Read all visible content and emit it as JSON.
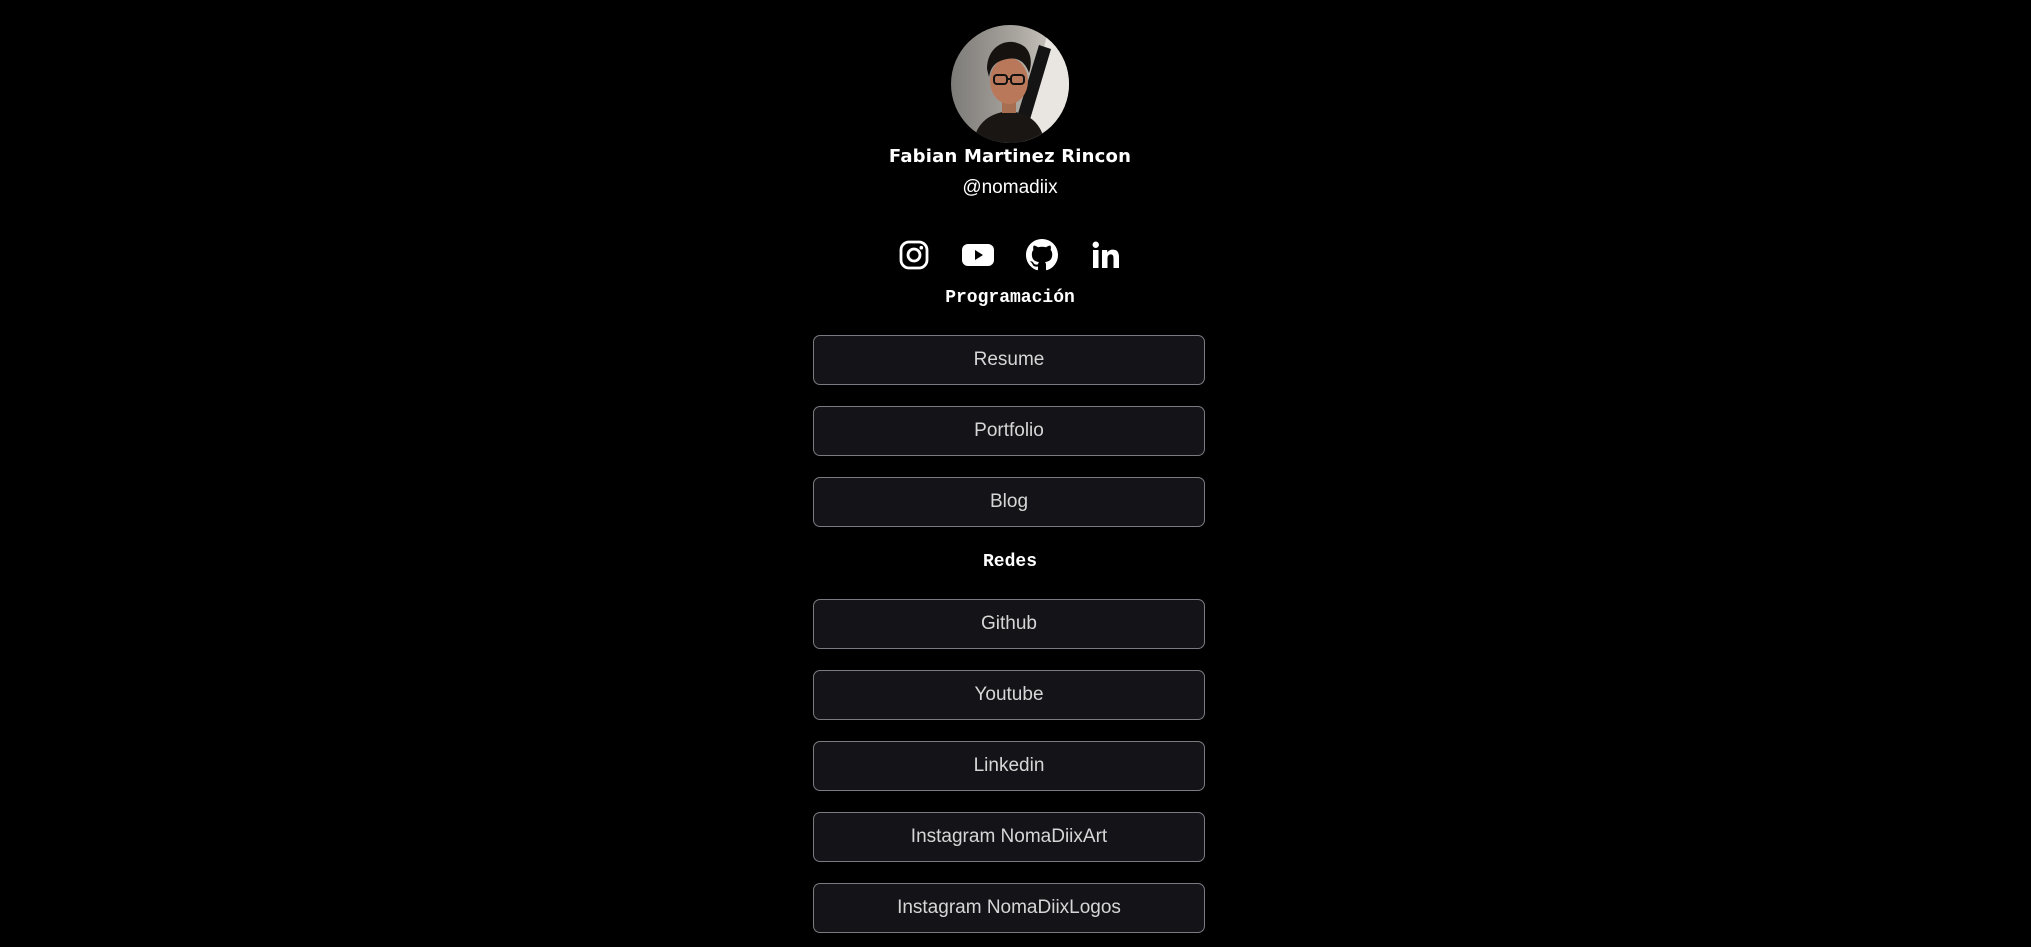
{
  "profile": {
    "name": "Fabian Martinez Rincon",
    "handle": "@nomadiix"
  },
  "socials": [
    {
      "icon": "instagram-icon"
    },
    {
      "icon": "youtube-icon"
    },
    {
      "icon": "github-icon"
    },
    {
      "icon": "linkedin-icon"
    }
  ],
  "sections": {
    "programacion": {
      "title": "Programación",
      "links": [
        "Resume",
        "Portfolio",
        "Blog"
      ]
    },
    "redes": {
      "title": "Redes",
      "links": [
        "Github",
        "Youtube",
        "Linkedin",
        "Instagram NomaDiixArt",
        "Instagram NomaDiixLogos"
      ]
    }
  },
  "colors": {
    "background": "#000000",
    "button_bg": "#131318",
    "button_border": "#7a7a80",
    "button_text": "#d6d6d6"
  }
}
